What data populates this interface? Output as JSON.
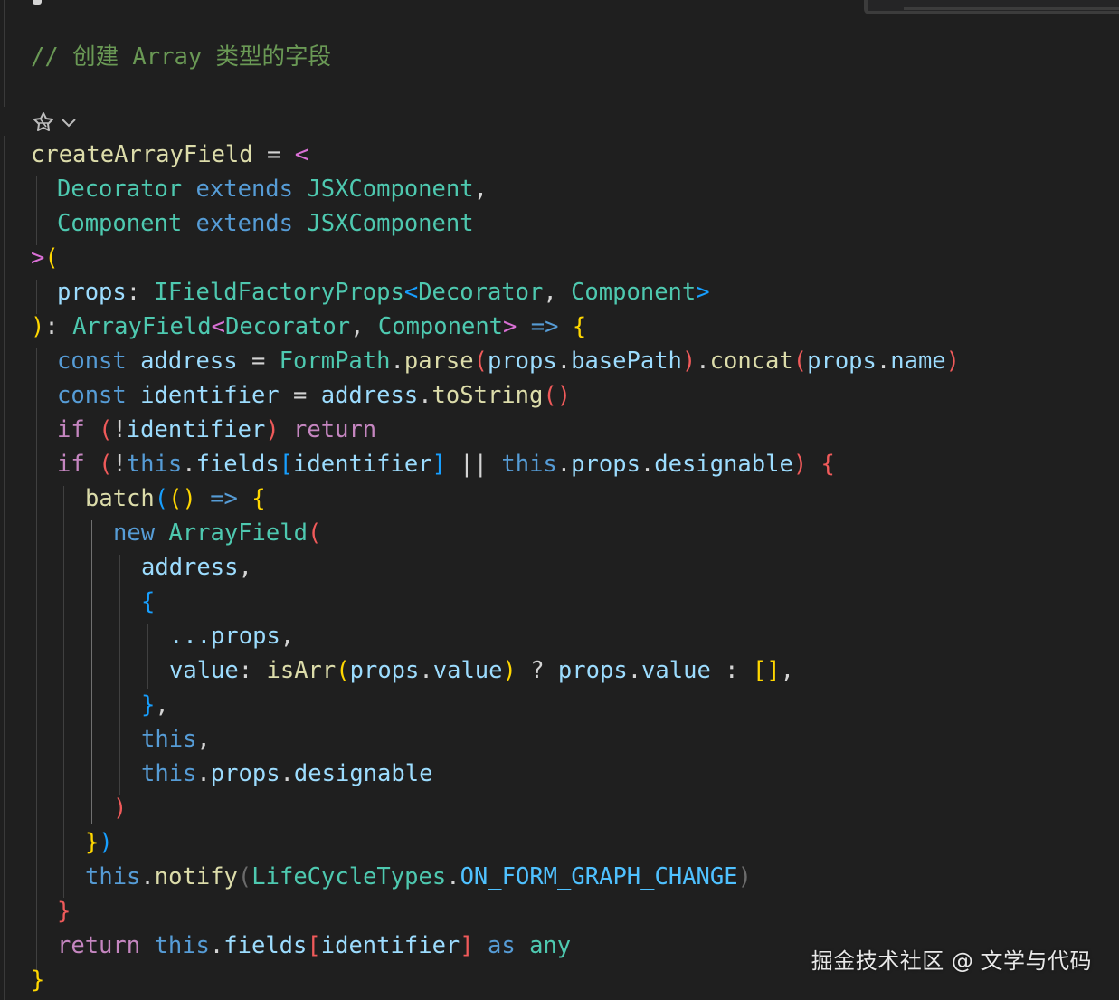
{
  "editor": {
    "comment": {
      "prefix": "// ",
      "text1": "创建",
      "word": " Array ",
      "text2": "类型的字段"
    },
    "codelens": {
      "icon": "copilot-sparkle-icon",
      "chevron": "chevron-down-icon"
    },
    "tokens": {
      "createArrayField": "createArrayField",
      "Decorator": "Decorator",
      "Component": "Component",
      "extends": "extends",
      "JSXComponent": "JSXComponent",
      "props": "props",
      "IFieldFactoryProps": "IFieldFactoryProps",
      "ArrayField": "ArrayField",
      "const": "const",
      "address": "address",
      "FormPath": "FormPath",
      "parse": "parse",
      "basePath": "basePath",
      "concat": "concat",
      "name": "name",
      "identifier": "identifier",
      "toString": "toString",
      "if": "if",
      "return": "return",
      "this": "this",
      "fields": "fields",
      "designable": "designable",
      "batch": "batch",
      "new": "new",
      "spread_props": "...props",
      "value": "value",
      "isArr": "isArr",
      "notify": "notify",
      "LifeCycleTypes": "LifeCycleTypes",
      "ON_FORM_GRAPH_CHANGE": "ON_FORM_GRAPH_CHANGE",
      "as": "as",
      "any": "any"
    }
  },
  "watermark": {
    "text": "掘金技术社区 @ 文学与代码"
  }
}
